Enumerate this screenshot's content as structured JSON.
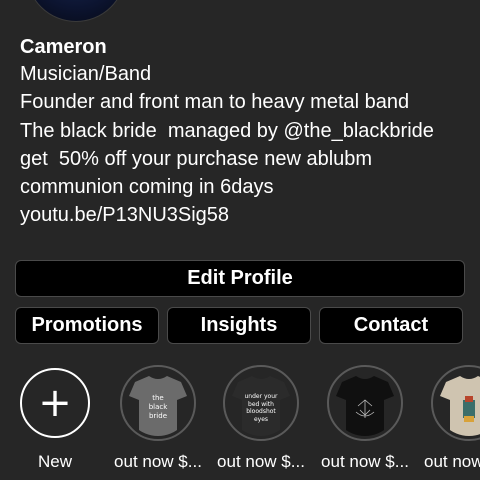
{
  "profile": {
    "name": "Cameron",
    "category": "Musician/Band",
    "bio_lines": [
      "Founder and front man to heavy metal band",
      "The black bride  managed by @the_blackbride",
      "get  50% off your purchase new ablubm",
      "communion coming in 6days",
      "youtu.be/P13NU3Sig58"
    ]
  },
  "buttons": {
    "edit_profile": "Edit Profile",
    "promotions": "Promotions",
    "insights": "Insights",
    "contact": "Contact"
  },
  "highlights": {
    "new_label": "New",
    "items": [
      {
        "caption": "out now $...",
        "shirt_color": "#6b6b6b",
        "shirt_text": "the\nblack\nbride"
      },
      {
        "caption": "out now $...",
        "shirt_color": "#2b2b2b",
        "shirt_text": "under your\nbed with\nbloodshot\neyes"
      },
      {
        "caption": "out now $...",
        "shirt_color": "#101010",
        "shirt_text": ""
      },
      {
        "caption": "out now",
        "shirt_color": "#cfc4b0",
        "shirt_text": ""
      }
    ]
  },
  "colors": {
    "background": "#262626",
    "button_bg": "#000000",
    "button_border": "#4a4a4a",
    "text": "#ffffff"
  }
}
